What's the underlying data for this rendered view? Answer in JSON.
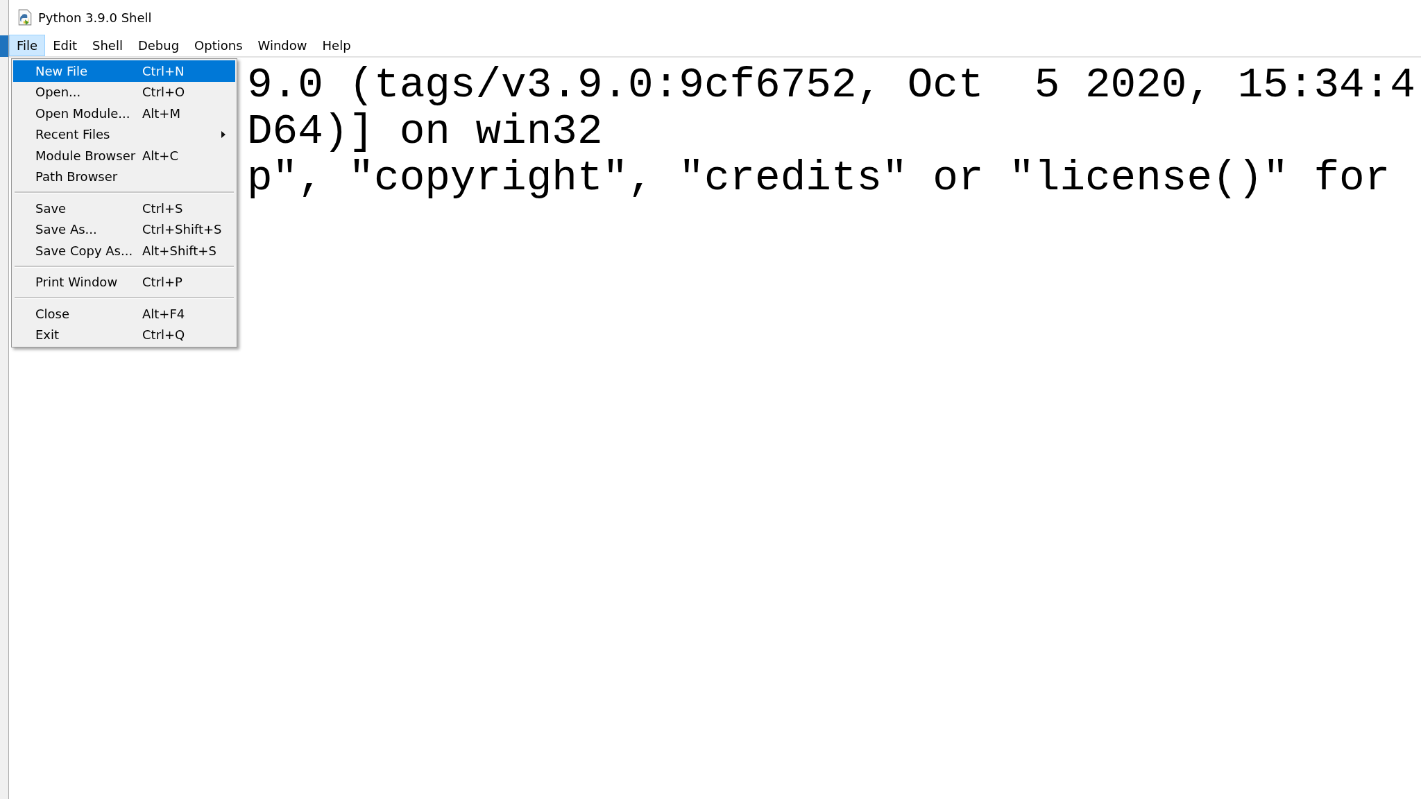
{
  "window": {
    "title": "Python 3.9.0 Shell"
  },
  "menubar": [
    {
      "label": "File",
      "selected": true
    },
    {
      "label": "Edit",
      "selected": false
    },
    {
      "label": "Shell",
      "selected": false
    },
    {
      "label": "Debug",
      "selected": false
    },
    {
      "label": "Options",
      "selected": false
    },
    {
      "label": "Window",
      "selected": false
    },
    {
      "label": "Help",
      "selected": false
    }
  ],
  "file_menu": [
    {
      "kind": "item",
      "label": "New File",
      "shortcut": "Ctrl+N",
      "selected": true,
      "submenu": false
    },
    {
      "kind": "item",
      "label": "Open...",
      "shortcut": "Ctrl+O",
      "selected": false,
      "submenu": false
    },
    {
      "kind": "item",
      "label": "Open Module...",
      "shortcut": "Alt+M",
      "selected": false,
      "submenu": false
    },
    {
      "kind": "item",
      "label": "Recent Files",
      "selected": false,
      "submenu": true
    },
    {
      "kind": "item",
      "label": "Module Browser",
      "shortcut": "Alt+C",
      "selected": false,
      "submenu": false
    },
    {
      "kind": "item",
      "label": "Path Browser",
      "selected": false,
      "submenu": false
    },
    {
      "kind": "separator"
    },
    {
      "kind": "item",
      "label": "Save",
      "shortcut": "Ctrl+S",
      "selected": false,
      "submenu": false
    },
    {
      "kind": "item",
      "label": "Save As...",
      "shortcut": "Ctrl+Shift+S",
      "selected": false,
      "submenu": false
    },
    {
      "kind": "item",
      "label": "Save Copy As...",
      "shortcut": "Alt+Shift+S",
      "selected": false,
      "submenu": false
    },
    {
      "kind": "separator"
    },
    {
      "kind": "item",
      "label": "Print Window",
      "shortcut": "Ctrl+P",
      "selected": false,
      "submenu": false
    },
    {
      "kind": "separator"
    },
    {
      "kind": "item",
      "label": "Close",
      "shortcut": "Alt+F4",
      "selected": false,
      "submenu": false
    },
    {
      "kind": "item",
      "label": "Exit",
      "shortcut": "Ctrl+Q",
      "selected": false,
      "submenu": false
    }
  ],
  "shell_lines": [
    "9.0 (tags/v3.9.0:9cf6752, Oct  5 2020, 15:34:4",
    "D64)] on win32",
    "p\", \"copyright\", \"credits\" or \"license()\" for"
  ]
}
